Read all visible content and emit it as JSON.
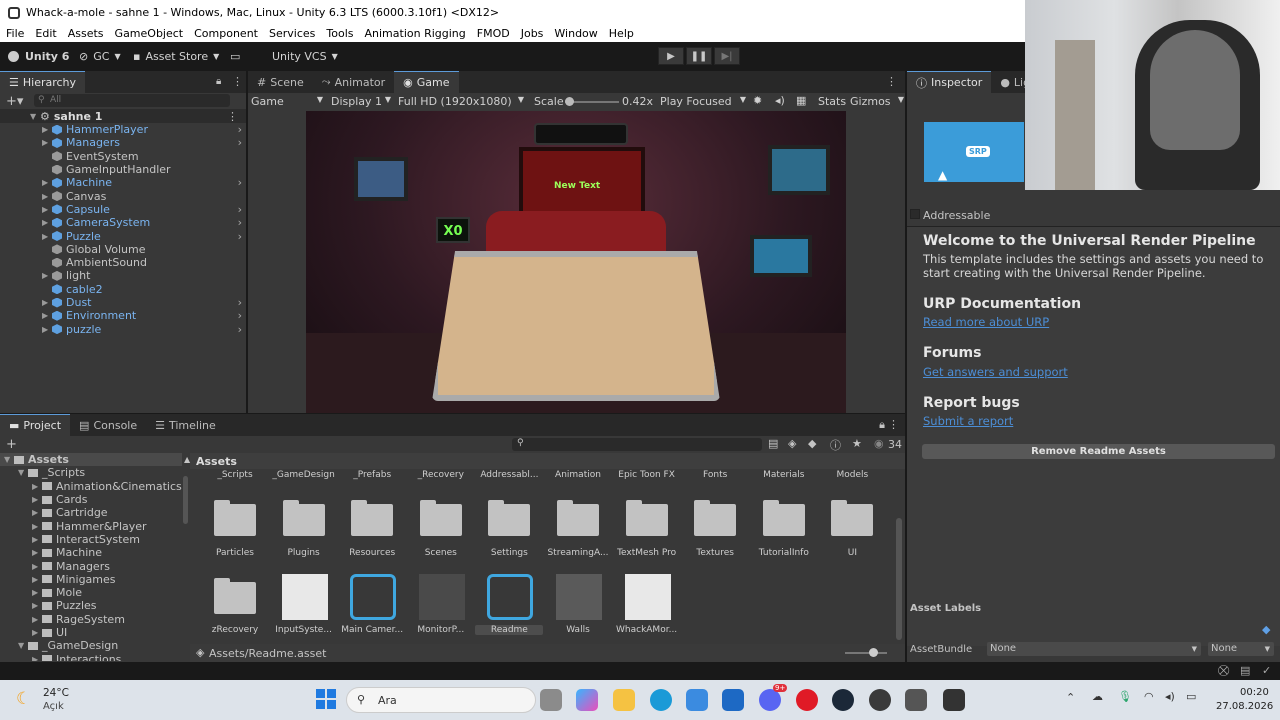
{
  "window": {
    "title": "Whack-a-mole - sahne 1 - Windows, Mac, Linux - Unity 6.3 LTS (6000.3.10f1) <DX12>"
  },
  "menu": [
    "File",
    "Edit",
    "Assets",
    "GameObject",
    "Component",
    "Services",
    "Tools",
    "Animation Rigging",
    "FMOD",
    "Jobs",
    "Window",
    "Help"
  ],
  "toolbar": {
    "unity": "Unity 6",
    "gc": "GC",
    "store": "Asset Store",
    "vcs": "Unity VCS"
  },
  "hierarchy": {
    "tab": "Hierarchy",
    "search": "All",
    "scene": "sahne 1",
    "items": [
      {
        "label": "HammerPlayer",
        "blue": true,
        "arrow": true,
        "more": true
      },
      {
        "label": "Managers",
        "blue": true,
        "arrow": true,
        "more": true
      },
      {
        "label": "EventSystem",
        "blue": false,
        "arrow": false,
        "more": false
      },
      {
        "label": "GameInputHandler",
        "blue": false,
        "arrow": false,
        "more": false
      },
      {
        "label": "Machine",
        "blue": true,
        "arrow": true,
        "more": true
      },
      {
        "label": "Canvas",
        "blue": false,
        "arrow": true,
        "more": false
      },
      {
        "label": "Capsule",
        "blue": true,
        "arrow": true,
        "more": true
      },
      {
        "label": "CameraSystem",
        "blue": true,
        "arrow": true,
        "more": true
      },
      {
        "label": "Puzzle",
        "blue": true,
        "arrow": true,
        "more": true
      },
      {
        "label": "Global Volume",
        "blue": false,
        "arrow": false,
        "more": false
      },
      {
        "label": "AmbientSound",
        "blue": false,
        "arrow": false,
        "more": false
      },
      {
        "label": "light",
        "blue": false,
        "arrow": true,
        "more": false
      },
      {
        "label": "cable2",
        "blue": true,
        "arrow": false,
        "more": false
      },
      {
        "label": "Dust",
        "blue": true,
        "arrow": true,
        "more": true
      },
      {
        "label": "Environment",
        "blue": true,
        "arrow": true,
        "more": true
      },
      {
        "label": "puzzle",
        "blue": true,
        "arrow": true,
        "more": true
      }
    ]
  },
  "gameview": {
    "tabs": [
      "Scene",
      "Animator",
      "Game"
    ],
    "display_mode": "Game",
    "display": "Display 1",
    "resolution": "Full HD (1920x1080)",
    "scale_label": "Scale",
    "scale": "0.42x",
    "play_mode": "Play Focused",
    "stats": "Stats",
    "gizmos": "Gizmos",
    "score_label": "X0",
    "screen_text": "New Text"
  },
  "project": {
    "tabs": [
      "Project",
      "Console",
      "Timeline"
    ],
    "root": "Assets",
    "count": "34",
    "path": "Assets/Readme.asset",
    "tree": [
      {
        "label": "Assets",
        "level": 0
      },
      {
        "label": "_Scripts",
        "level": 1
      },
      {
        "label": "Animation&Cinematics",
        "level": 2
      },
      {
        "label": "Cards",
        "level": 2
      },
      {
        "label": "Cartridge",
        "level": 2
      },
      {
        "label": "Hammer&Player",
        "level": 2
      },
      {
        "label": "InteractSystem",
        "level": 2
      },
      {
        "label": "Machine",
        "level": 2
      },
      {
        "label": "Managers",
        "level": 2
      },
      {
        "label": "Minigames",
        "level": 2
      },
      {
        "label": "Mole",
        "level": 2
      },
      {
        "label": "Puzzles",
        "level": 2
      },
      {
        "label": "RageSystem",
        "level": 2
      },
      {
        "label": "UI",
        "level": 2
      },
      {
        "label": "_GameDesign",
        "level": 1
      },
      {
        "label": "Interactions",
        "level": 2
      }
    ],
    "row1": [
      "_Scripts",
      "_GameDesign",
      "_Prefabs",
      "_Recovery",
      "Addressabl...",
      "Animation",
      "Epic Toon FX",
      "Fonts",
      "Materials",
      "Models"
    ],
    "row2": [
      "Particles",
      "Plugins",
      "Resources",
      "Scenes",
      "Settings",
      "StreamingA...",
      "TextMesh Pro",
      "Textures",
      "TutorialInfo",
      "UI"
    ],
    "row3": [
      "zRecovery",
      "InputSyste...",
      "Main Camer...",
      "MonitorP...",
      "Readme",
      "Walls",
      "WhackAMor..."
    ]
  },
  "inspector": {
    "tabs": [
      "Inspector",
      "Ligh"
    ],
    "addressable": "Addressable",
    "badge": "SRP",
    "welcome_title": "Welcome to the Universal Render Pipeline",
    "welcome_body": "This template includes the settings and assets you need to start creating with the Universal Render Pipeline.",
    "doc_title": "URP Documentation",
    "doc_link": "Read more about URP",
    "forums_title": "Forums",
    "forums_link": "Get answers and support",
    "bugs_title": "Report bugs",
    "bugs_link": "Submit a report",
    "remove_btn": "Remove Readme Assets",
    "labels": "Asset Labels",
    "bundle_label": "AssetBundle",
    "bundle_value": "None",
    "bundle_variant": "None"
  },
  "taskbar": {
    "temp": "24°C",
    "weather": "Açık",
    "search": "Ara",
    "time": "00:20",
    "date": "27.08.2026",
    "badge": "9+"
  }
}
